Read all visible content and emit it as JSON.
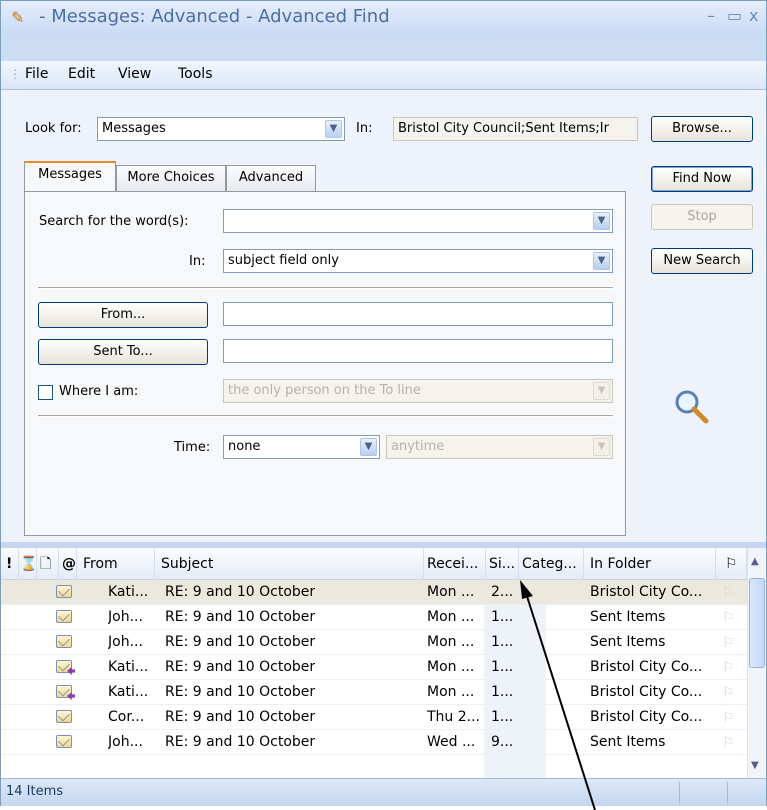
{
  "window": {
    "title": "- Messages: Advanced - Advanced Find",
    "minimize": "–",
    "maximize": "▭",
    "close": "x"
  },
  "menu": [
    "File",
    "Edit",
    "View",
    "Tools"
  ],
  "lookfor": {
    "label": "Look for:",
    "value": "Messages",
    "in_label": "In:",
    "in_value": "Bristol City Council;Sent Items;Ir",
    "browse": "Browse..."
  },
  "tabs": [
    "Messages",
    "More Choices",
    "Advanced"
  ],
  "form": {
    "search_label": "Search for the word(s):",
    "search_value": "",
    "in_label": "In:",
    "in_value": "subject field only",
    "from_button": "From...",
    "from_value": "",
    "sentto_button": "Sent To...",
    "sentto_value": "",
    "whereiam_label": "Where I am:",
    "whereiam_value": "the only person on the To line",
    "time_label": "Time:",
    "time_value": "none",
    "time_range": "anytime"
  },
  "actions": {
    "find_now": "Find Now",
    "stop": "Stop",
    "new_search": "New Search"
  },
  "results": {
    "headers": {
      "importance": "!",
      "reminder": "⌛",
      "icon": "🗋",
      "attachment": "@",
      "from": "From",
      "subject": "Subject",
      "received": "Recei...",
      "size": "Si...",
      "categories": "Categ...",
      "folder": "In Folder",
      "flag": "⚐"
    },
    "rows": [
      {
        "from": "Kati...",
        "subject": "RE: 9 and 10 October",
        "received": "Mon ...",
        "size": "2...",
        "folder": "Bristol City Co...",
        "icon": "envelope-icon",
        "selected": true
      },
      {
        "from": "Joh...",
        "subject": "RE: 9 and 10 October",
        "received": "Mon ...",
        "size": "1...",
        "folder": "Sent Items",
        "icon": "envelope-icon",
        "selected": false
      },
      {
        "from": "Joh...",
        "subject": "RE: 9 and 10 October",
        "received": "Mon ...",
        "size": "1...",
        "folder": "Sent Items",
        "icon": "envelope-icon",
        "selected": false
      },
      {
        "from": "Kati...",
        "subject": "RE: 9 and 10 October",
        "received": "Mon ...",
        "size": "1...",
        "folder": "Bristol City Co...",
        "icon": "replied-envelope-icon",
        "selected": false
      },
      {
        "from": "Kati...",
        "subject": "RE: 9 and 10 October",
        "received": "Mon ...",
        "size": "1...",
        "folder": "Bristol City Co...",
        "icon": "replied-envelope-icon",
        "selected": false
      },
      {
        "from": "Cor...",
        "subject": "RE: 9 and 10 October",
        "received": "Thu 2...",
        "size": "1...",
        "folder": "Bristol City Co...",
        "icon": "envelope-icon",
        "selected": false
      },
      {
        "from": "Joh...",
        "subject": "RE: 9 and 10 October",
        "received": "Wed ...",
        "size": "9...",
        "folder": "Sent Items",
        "icon": "envelope-icon",
        "selected": false
      }
    ]
  },
  "status": {
    "count": "14 Items"
  }
}
